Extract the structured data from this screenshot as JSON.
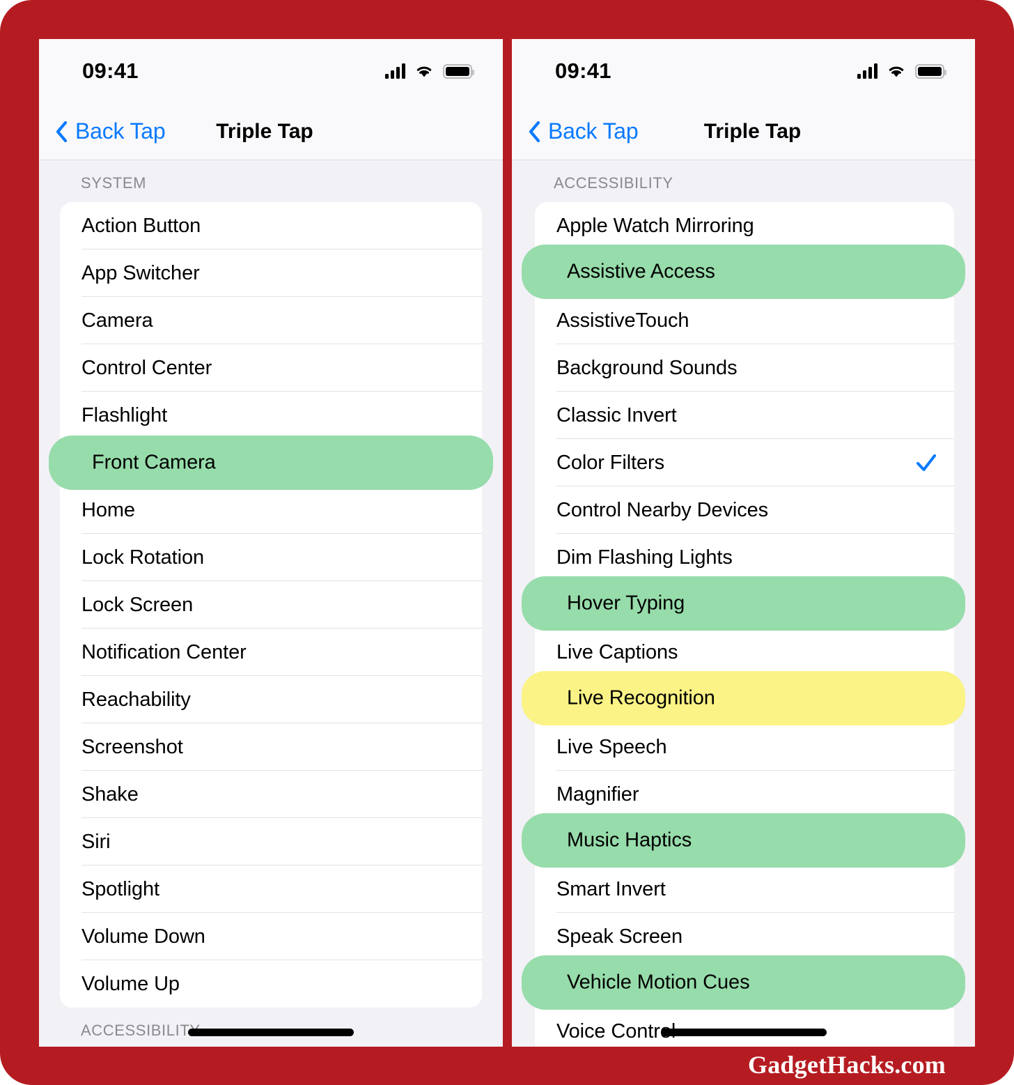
{
  "watermark": "GadgetHacks.com",
  "colors": {
    "frame_red": "#b51c21",
    "highlight_green": "#97dcab",
    "highlight_yellow": "#fbf385",
    "accent_blue": "#0a7aff",
    "card_white": "#ffffff",
    "page_gray": "#f2f1f6"
  },
  "left_phone": {
    "status": {
      "time": "09:41",
      "cellular_icon": "signal-bars-icon",
      "wifi_icon": "wifi-icon",
      "battery_icon": "battery-icon"
    },
    "nav": {
      "back_label": "Back Tap",
      "back_icon": "chevron-left-icon",
      "title": "Triple Tap"
    },
    "section_header": "SYSTEM",
    "rows": [
      {
        "label": "Action Button",
        "highlight": "none",
        "checked": false
      },
      {
        "label": "App Switcher",
        "highlight": "none",
        "checked": false
      },
      {
        "label": "Camera",
        "highlight": "none",
        "checked": false
      },
      {
        "label": "Control Center",
        "highlight": "none",
        "checked": false
      },
      {
        "label": "Flashlight",
        "highlight": "none",
        "checked": false
      },
      {
        "label": "Front Camera",
        "highlight": "green",
        "checked": false
      },
      {
        "label": "Home",
        "highlight": "none",
        "checked": false
      },
      {
        "label": "Lock Rotation",
        "highlight": "none",
        "checked": false
      },
      {
        "label": "Lock Screen",
        "highlight": "none",
        "checked": false
      },
      {
        "label": "Notification Center",
        "highlight": "none",
        "checked": false
      },
      {
        "label": "Reachability",
        "highlight": "none",
        "checked": false
      },
      {
        "label": "Screenshot",
        "highlight": "none",
        "checked": false
      },
      {
        "label": "Shake",
        "highlight": "none",
        "checked": false
      },
      {
        "label": "Siri",
        "highlight": "none",
        "checked": false
      },
      {
        "label": "Spotlight",
        "highlight": "none",
        "checked": false
      },
      {
        "label": "Volume Down",
        "highlight": "none",
        "checked": false
      },
      {
        "label": "Volume Up",
        "highlight": "none",
        "checked": false
      }
    ],
    "next_section_header": "ACCESSIBILITY"
  },
  "right_phone": {
    "status": {
      "time": "09:41",
      "cellular_icon": "signal-bars-icon",
      "wifi_icon": "wifi-icon",
      "battery_icon": "battery-icon"
    },
    "nav": {
      "back_label": "Back Tap",
      "back_icon": "chevron-left-icon",
      "title": "Triple Tap"
    },
    "section_header": "ACCESSIBILITY",
    "rows": [
      {
        "label": "Apple Watch Mirroring",
        "highlight": "none",
        "checked": false
      },
      {
        "label": "Assistive Access",
        "highlight": "green",
        "checked": false
      },
      {
        "label": "AssistiveTouch",
        "highlight": "none",
        "checked": false
      },
      {
        "label": "Background Sounds",
        "highlight": "none",
        "checked": false
      },
      {
        "label": "Classic Invert",
        "highlight": "none",
        "checked": false
      },
      {
        "label": "Color Filters",
        "highlight": "none",
        "checked": true
      },
      {
        "label": "Control Nearby Devices",
        "highlight": "none",
        "checked": false
      },
      {
        "label": "Dim Flashing Lights",
        "highlight": "none",
        "checked": false
      },
      {
        "label": "Hover Typing",
        "highlight": "green",
        "checked": false
      },
      {
        "label": "Live Captions",
        "highlight": "none",
        "checked": false
      },
      {
        "label": "Live Recognition",
        "highlight": "yellow",
        "checked": false
      },
      {
        "label": "Live Speech",
        "highlight": "none",
        "checked": false
      },
      {
        "label": "Magnifier",
        "highlight": "none",
        "checked": false
      },
      {
        "label": "Music Haptics",
        "highlight": "green",
        "checked": false
      },
      {
        "label": "Smart Invert",
        "highlight": "none",
        "checked": false
      },
      {
        "label": "Speak Screen",
        "highlight": "none",
        "checked": false
      },
      {
        "label": "Vehicle Motion Cues",
        "highlight": "green",
        "checked": false
      },
      {
        "label": "Voice Control",
        "highlight": "none",
        "checked": false
      }
    ]
  }
}
